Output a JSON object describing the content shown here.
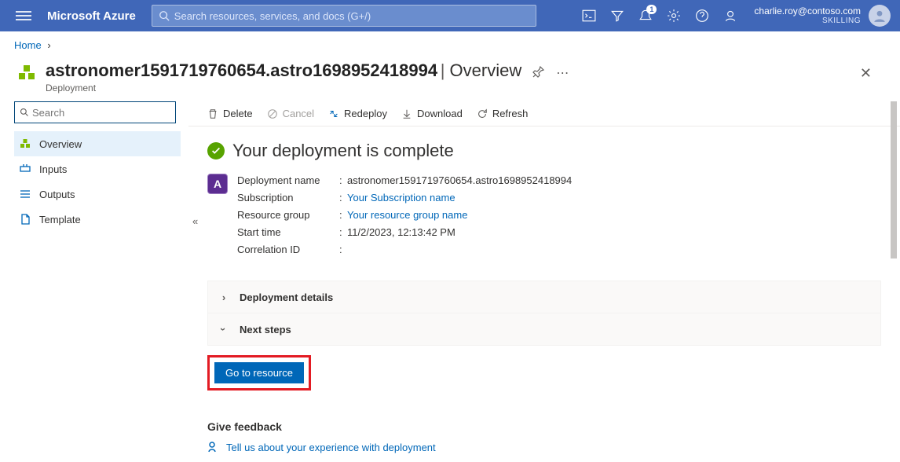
{
  "header": {
    "brand": "Microsoft Azure",
    "search_placeholder": "Search resources, services, and docs (G+/)",
    "notification_count": "1",
    "user_email": "charlie.roy@contoso.com",
    "tenant": "SKILLING"
  },
  "breadcrumb": {
    "items": [
      "Home"
    ],
    "sep": "›"
  },
  "resource": {
    "title": "astronomer1591719760654.astro1698952418994",
    "section": "Overview",
    "type": "Deployment"
  },
  "sidebar": {
    "search_placeholder": "Search",
    "items": [
      {
        "label": "Overview",
        "icon": "cubes-green",
        "active": true
      },
      {
        "label": "Inputs",
        "icon": "input"
      },
      {
        "label": "Outputs",
        "icon": "output"
      },
      {
        "label": "Template",
        "icon": "template"
      }
    ]
  },
  "toolbar": {
    "delete": "Delete",
    "cancel": "Cancel",
    "redeploy": "Redeploy",
    "download": "Download",
    "refresh": "Refresh"
  },
  "status": {
    "title": "Your deployment is complete",
    "fields": [
      {
        "k": "Deployment name",
        "v": "astronomer1591719760654.astro1698952418994",
        "link": false
      },
      {
        "k": "Subscription",
        "v": "Your Subscription name",
        "link": true
      },
      {
        "k": "Resource group",
        "v": "Your resource group name",
        "link": true
      },
      {
        "k": "Start time",
        "v": "11/2/2023, 12:13:42 PM",
        "link": false
      },
      {
        "k": "Correlation ID",
        "v": "",
        "link": false
      }
    ]
  },
  "collapsibles": {
    "details": "Deployment details",
    "next": "Next steps"
  },
  "buttons": {
    "goto": "Go to resource"
  },
  "feedback": {
    "heading": "Give feedback",
    "link": "Tell us about your experience with deployment"
  }
}
